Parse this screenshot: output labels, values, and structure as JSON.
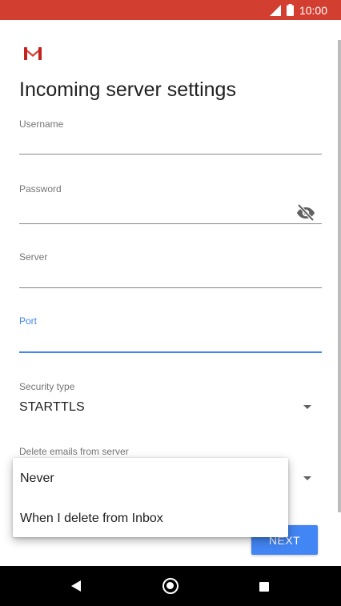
{
  "status_bar": {
    "time": "10:00",
    "bg_color": "#d23f31",
    "icons": [
      "signal-icon",
      "battery-icon"
    ]
  },
  "app": {
    "logo": "gmail-logo",
    "title": "Incoming server settings"
  },
  "fields": {
    "username": {
      "label": "Username",
      "value": ""
    },
    "password": {
      "label": "Password",
      "value": "",
      "icon": "visibility-off-icon"
    },
    "server": {
      "label": "Server",
      "value": ""
    },
    "port": {
      "label": "Port",
      "value": "",
      "focused": true
    }
  },
  "security_type": {
    "label": "Security type",
    "value": "STARTTLS"
  },
  "delete_emails": {
    "label": "Delete emails from server"
  },
  "popup_menu": {
    "options": [
      "Never",
      "When I delete from Inbox"
    ]
  },
  "actions": {
    "next_label": "NEXT"
  },
  "colors": {
    "accent": "#4285f4",
    "gmail_red": "#d23f31"
  },
  "nav_bar": {
    "icons": [
      "back-icon",
      "home-icon",
      "recent-apps-icon"
    ]
  }
}
